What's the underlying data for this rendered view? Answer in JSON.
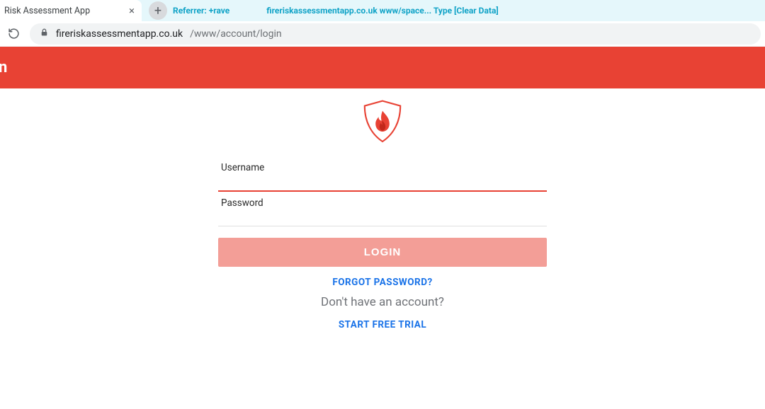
{
  "browser": {
    "tab_title": "Risk Assessment App",
    "info_left": "Referrer: +rave",
    "info_center": "fireriskassessmentapp.co.uk www/space... Type [Clear Data]",
    "url_host": "fireriskassessmentapp.co.uk",
    "url_path": "/www/account/login"
  },
  "banner_fragment": "n",
  "form": {
    "username_label": "Username",
    "password_label": "Password",
    "login_label": "LOGIN",
    "forgot_label": "FORGOT PASSWORD?",
    "no_account_label": "Don't have an account?",
    "trial_label": "START FREE TRIAL"
  }
}
